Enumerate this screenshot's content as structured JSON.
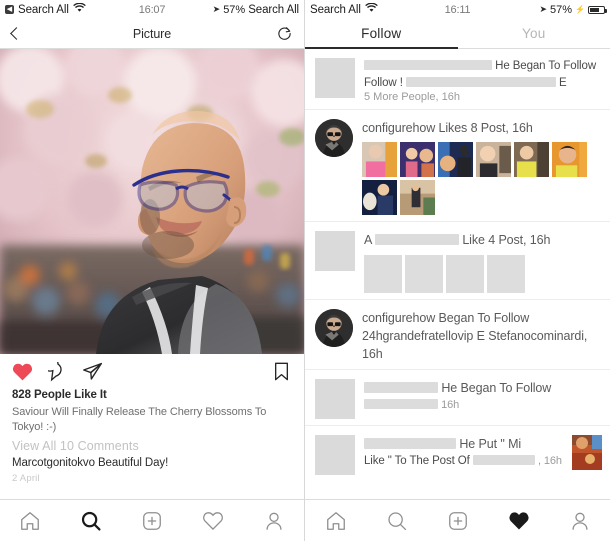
{
  "left_phone": {
    "status_bar": {
      "back_chip_icon": "back-chip-icon",
      "carrier": "Search All",
      "wifi_icon": "wifi-icon",
      "time": "16:07",
      "location_icon": "location-arrow-icon",
      "battery_percent": "57%",
      "battery_icon": "battery-icon"
    },
    "nav": {
      "back_icon": "chevron-left-icon",
      "title": "Picture",
      "refresh_icon": "refresh-icon"
    },
    "photo": {
      "alt": "man-with-glasses-under-cherry-blossoms"
    },
    "actions": {
      "like_icon": "heart-filled-icon",
      "like_color": "#ed4956",
      "comment_icon": "comment-bubble-icon",
      "share_icon": "paper-plane-icon",
      "save_icon": "bookmark-icon"
    },
    "post": {
      "likes": "828 People Like It",
      "caption": "Saviour Will Finally Release The Cherry Blossoms To Tokyo! :-)",
      "view_comments": "View All 10 Comments",
      "comment": "Marcotgonitokvo Beautiful Day!",
      "date": "2 April"
    },
    "bottom_nav": {
      "items": [
        {
          "name": "home",
          "icon": "home-icon",
          "active": false
        },
        {
          "name": "search",
          "icon": "search-icon",
          "active": true
        },
        {
          "name": "add",
          "icon": "plus-square-icon",
          "active": false
        },
        {
          "name": "activity",
          "icon": "heart-outline-icon",
          "active": false
        },
        {
          "name": "profile",
          "icon": "person-icon",
          "active": false
        }
      ]
    }
  },
  "right_phone": {
    "status_bar": {
      "carrier": "Search All",
      "wifi_icon": "wifi-icon",
      "time": "16:11",
      "location_icon": "location-arrow-icon",
      "battery_percent": "57%",
      "charging_icon": "bolt-icon",
      "battery_icon": "battery-icon"
    },
    "tabs": [
      {
        "label": "Follow",
        "active": true
      },
      {
        "label": "You",
        "active": false
      }
    ],
    "activity": [
      {
        "avatar": "gray-square-placeholder",
        "text_a": "",
        "text_b": "He Began To Follow",
        "text_c": "",
        "sub": "5 More People, 16h",
        "redacted": true,
        "thumbs": 0
      },
      {
        "avatar": "circle-portrait",
        "text_a": "configurehow Likes 8 Post, 16h",
        "sub": "",
        "redacted": false,
        "thumbs": 8
      },
      {
        "avatar": "gray-square-placeholder",
        "text_a": "A",
        "text_b": "Like 4 Post, 16h",
        "sub": "",
        "redacted": true,
        "thumbs": 4
      },
      {
        "avatar": "circle-portrait",
        "text_a": "configurehow Began To Follow 24hgrandefratellovip E Stefanocominardi, 16h",
        "sub": "",
        "redacted": false,
        "thumbs": 0
      },
      {
        "avatar": "gray-square-placeholder",
        "text_a": "",
        "text_b": "He Began To Follow",
        "sub": "16h",
        "redacted": true,
        "thumbs": 0
      },
      {
        "avatar": "gray-square-placeholder",
        "text_a": "",
        "text_b": "He Put \" Mi",
        "text_c": "Like \" To The Post Of",
        "sub": ", 16h",
        "redacted": true,
        "thumbs": 0,
        "side_thumb": true
      }
    ],
    "bottom_nav": {
      "items": [
        {
          "name": "home",
          "icon": "home-icon",
          "active": false
        },
        {
          "name": "search",
          "icon": "search-icon",
          "active": false
        },
        {
          "name": "add",
          "icon": "plus-square-icon",
          "active": false
        },
        {
          "name": "activity",
          "icon": "heart-filled-icon",
          "active": true
        },
        {
          "name": "profile",
          "icon": "person-icon",
          "active": false
        }
      ]
    }
  }
}
